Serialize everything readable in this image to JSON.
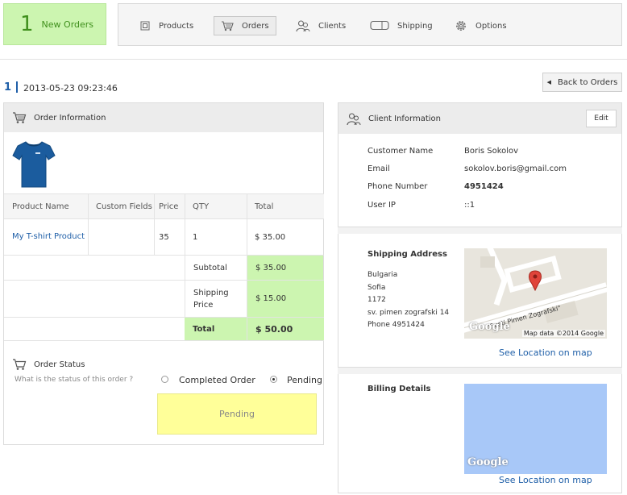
{
  "header": {
    "new_orders_count": "1",
    "new_orders_label": "New Orders",
    "nav": [
      {
        "label": "Products",
        "icon": "box-icon"
      },
      {
        "label": "Orders",
        "icon": "cart-icon",
        "active": true
      },
      {
        "label": "Clients",
        "icon": "users-icon"
      },
      {
        "label": "Shipping",
        "icon": "truck-icon"
      },
      {
        "label": "Options",
        "icon": "gear-icon"
      }
    ]
  },
  "order": {
    "id": "1",
    "datetime": "2013-05-23 09:23:46",
    "back_label": "Back to Orders"
  },
  "order_info": {
    "title": "Order Information",
    "columns": [
      "Product Name",
      "Custom Fields",
      "Price",
      "QTY",
      "Total"
    ],
    "rows": [
      {
        "product": "My T-shirt Product",
        "custom_fields": "",
        "price": "35",
        "qty": "1",
        "total": "$ 35.00"
      }
    ],
    "subtotal_label": "Subtotal",
    "subtotal_value": "$ 35.00",
    "shipping_label": "Shipping Price",
    "shipping_value": "$ 15.00",
    "total_label": "Total",
    "total_value": "$ 50.00"
  },
  "order_status": {
    "title": "Order Status",
    "question": "What is the status of this order ?",
    "options": [
      "Completed Order",
      "Pending"
    ],
    "selected": "Pending",
    "current": "Pending"
  },
  "client_info": {
    "title": "Client Information",
    "edit_label": "Edit",
    "fields": [
      {
        "label": "Customer Name",
        "value": "Boris Sokolov"
      },
      {
        "label": "Email",
        "value": "sokolov.boris@gmail.com"
      },
      {
        "label": "Phone Number",
        "value": "4951424"
      },
      {
        "label": "User IP",
        "value": "::1"
      }
    ]
  },
  "shipping": {
    "title": "Shipping Address",
    "lines": [
      "Bulgaria",
      "Sofia",
      "1172",
      "sv. pimen zografski 14",
      "Phone 4951424"
    ],
    "map_street": "\"Sveti Pimen Zografski\"",
    "map_brand": "Google",
    "map_credit": "Map data ©2014 Google",
    "map_link": "See Location on map"
  },
  "billing": {
    "title": "Billing Details",
    "map_brand": "Google",
    "map_link": "See Location on map"
  },
  "colors": {
    "accent_green": "#ccf5b0",
    "link_blue": "#1f5fa8",
    "pending_yellow": "#ffff99",
    "map_blue": "#a8c8f8"
  }
}
